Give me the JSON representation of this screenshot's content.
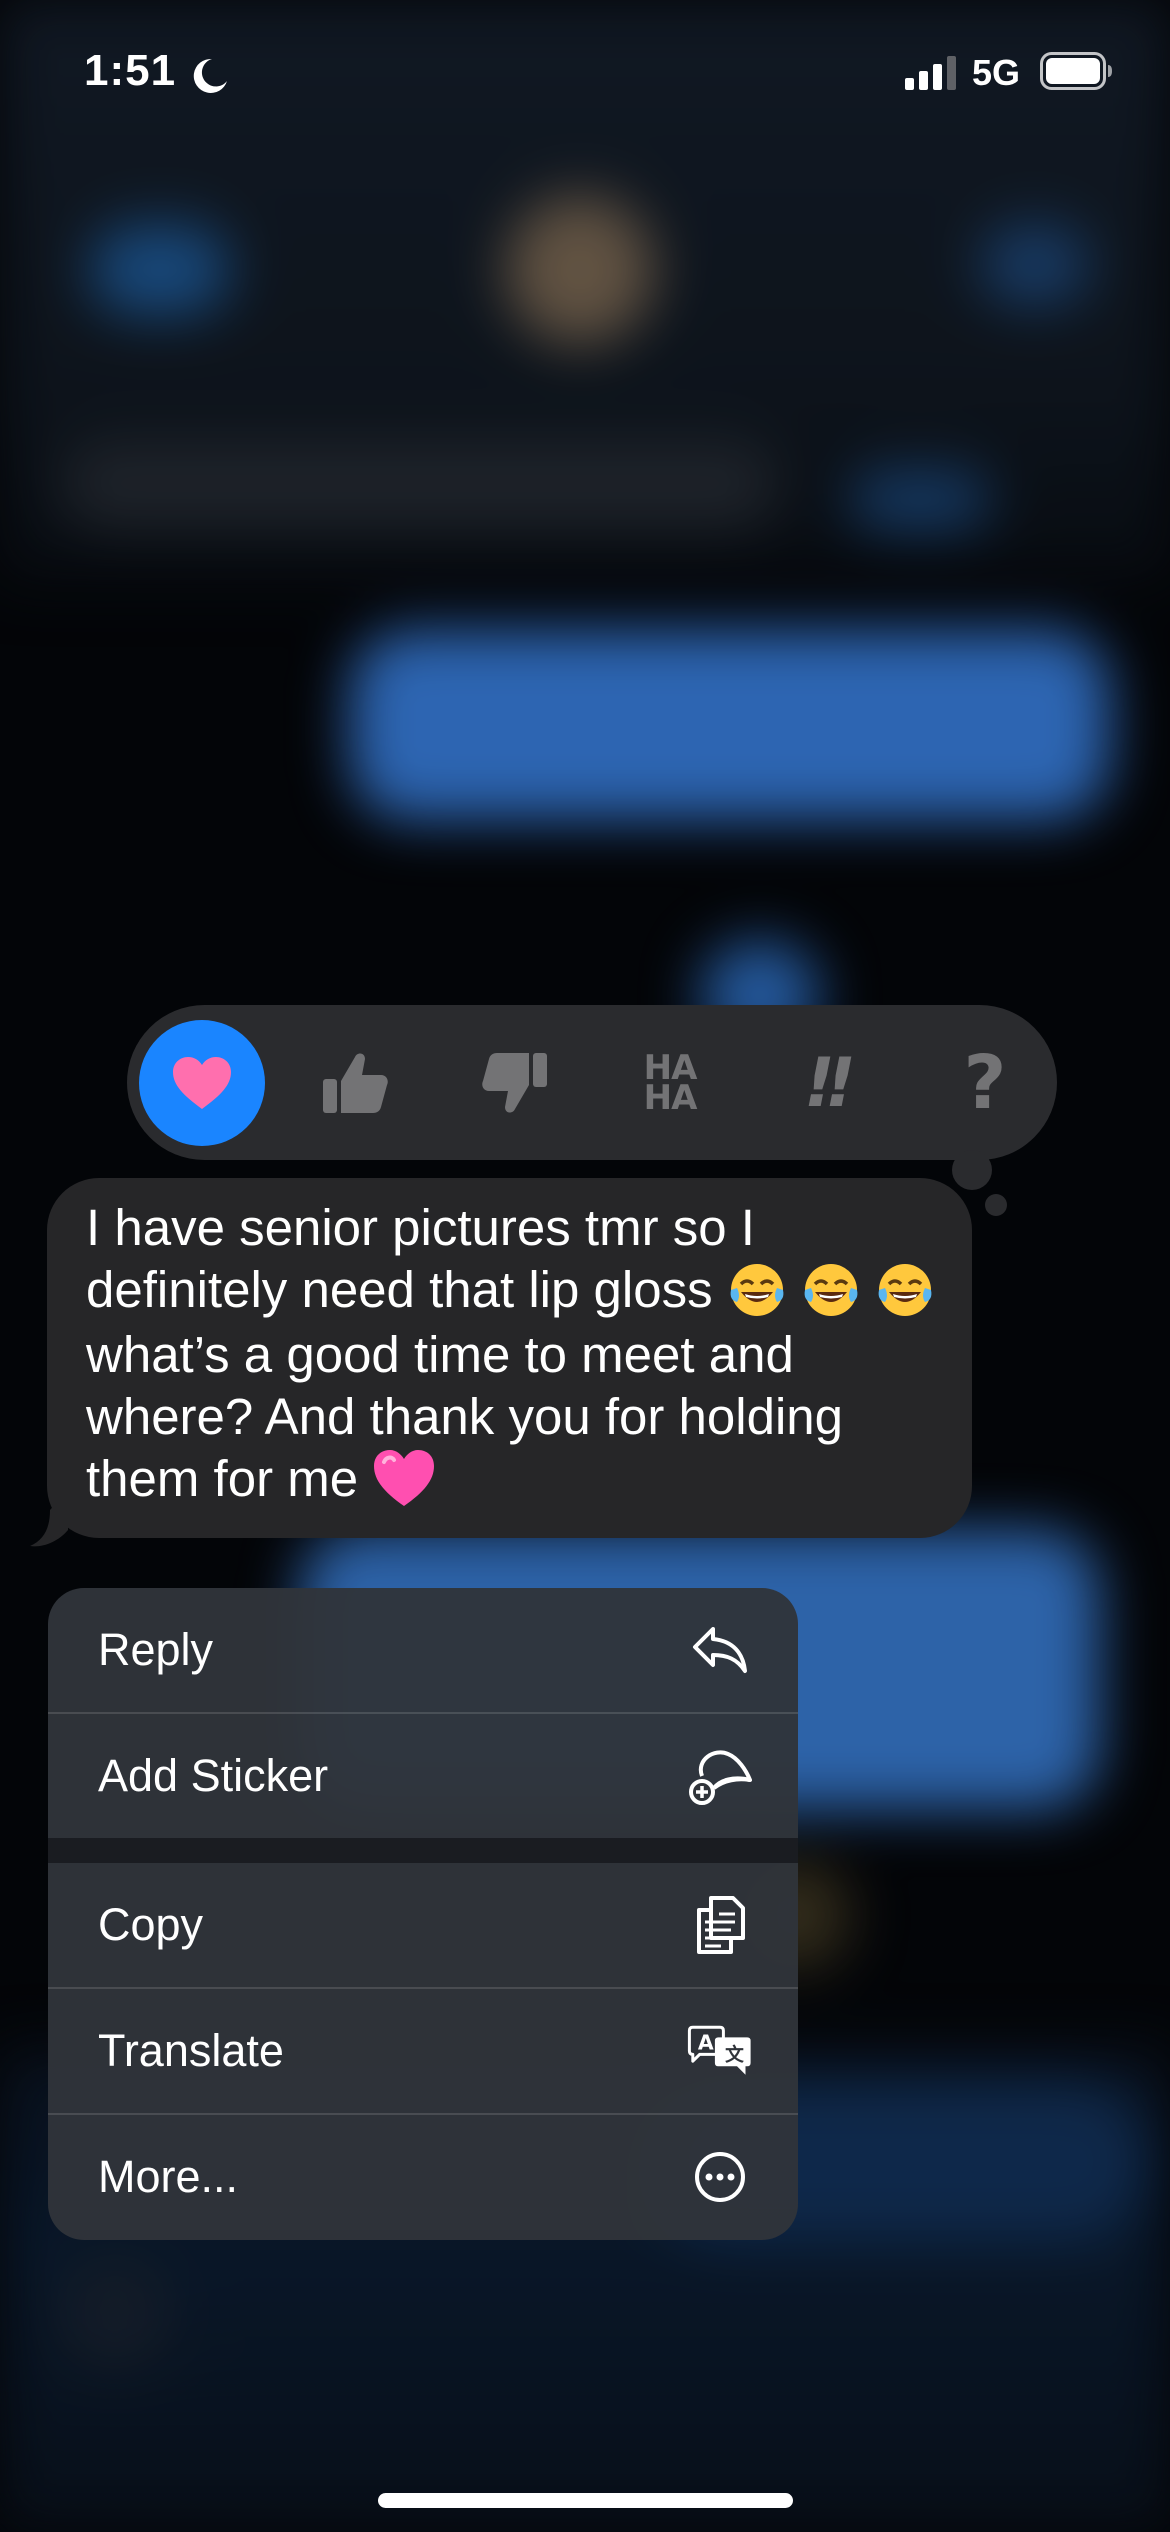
{
  "status_bar": {
    "time": "1:51",
    "network": "5G",
    "icons": [
      "moon-icon",
      "signal-icon",
      "battery-icon"
    ]
  },
  "tapbacks": [
    {
      "name": "heart",
      "selected": true
    },
    {
      "name": "thumbs-up",
      "selected": false
    },
    {
      "name": "thumbs-down",
      "selected": false
    },
    {
      "name": "haha",
      "selected": false,
      "label": "HA HA"
    },
    {
      "name": "exclamation",
      "selected": false,
      "label": "!!"
    },
    {
      "name": "question",
      "selected": false,
      "label": "?"
    }
  ],
  "message": {
    "text_part1": "I have senior pictures tmr so I definitely need that lip gloss",
    "text_part2": "what’s a good time to meet and where? And thank you for holding them for me",
    "emojis": [
      "face-with-tears-of-joy",
      "face-with-tears-of-joy",
      "face-with-tears-of-joy",
      "pink-heart"
    ]
  },
  "menu": {
    "items": [
      {
        "label": "Reply",
        "icon": "reply-icon"
      },
      {
        "label": "Add Sticker",
        "icon": "add-sticker-icon"
      },
      {
        "label": "Copy",
        "icon": "copy-icon"
      },
      {
        "label": "Translate",
        "icon": "translate-icon"
      },
      {
        "label": "More...",
        "icon": "more-icon"
      }
    ]
  },
  "colors": {
    "accent_blue": "#1a85ff",
    "heart_pink": "#ff6fae",
    "bubble_gray": "#262628",
    "menu_bg": "#30343a"
  }
}
